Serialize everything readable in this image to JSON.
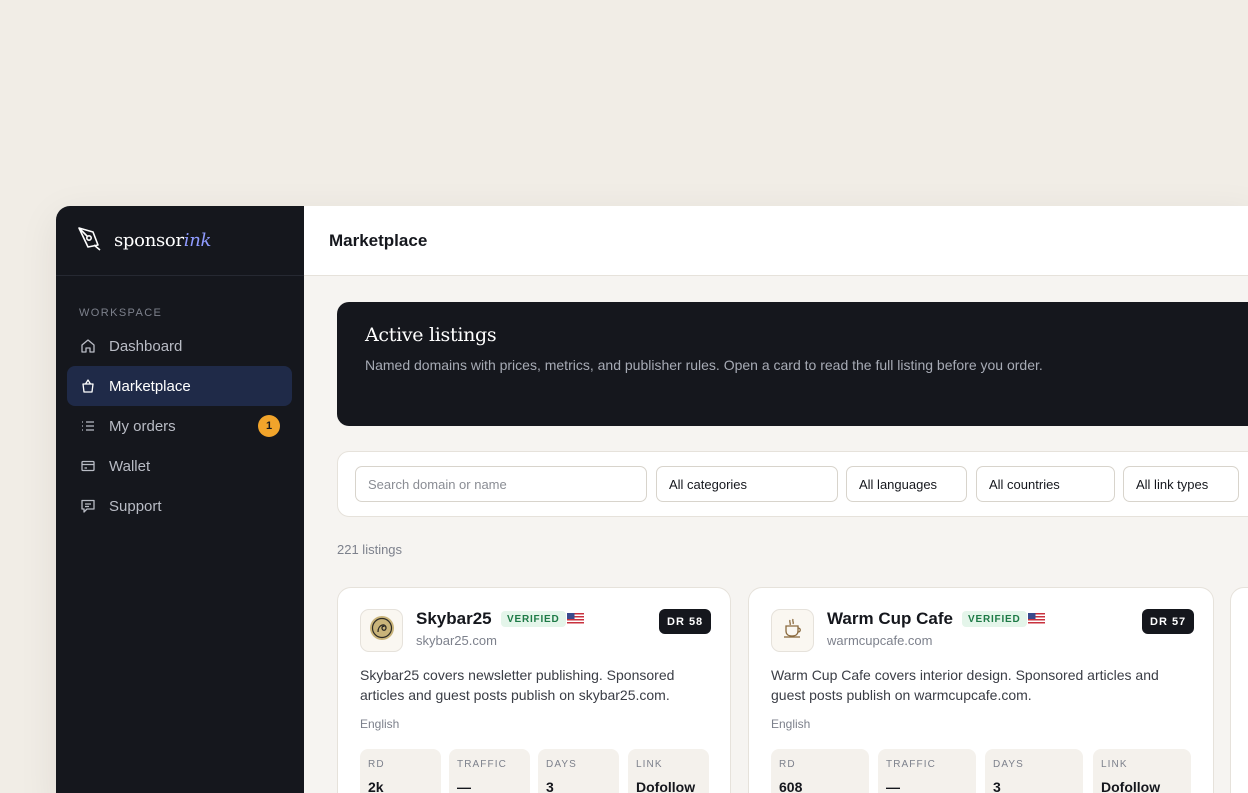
{
  "brand": {
    "name_plain": "sponsor",
    "name_accent": "ink"
  },
  "sidebar": {
    "section_label": "WORKSPACE",
    "items": [
      {
        "label": "Dashboard",
        "icon": "home-icon"
      },
      {
        "label": "Marketplace",
        "icon": "shopping-bag-icon",
        "active": true
      },
      {
        "label": "My orders",
        "icon": "list-icon",
        "badge": "1"
      },
      {
        "label": "Wallet",
        "icon": "wallet-icon"
      },
      {
        "label": "Support",
        "icon": "message-icon"
      }
    ]
  },
  "topbar": {
    "title": "Marketplace"
  },
  "hero": {
    "title": "Active listings",
    "description": "Named domains with prices, metrics, and publisher rules. Open a card to read the full listing before you order."
  },
  "filters": {
    "search_placeholder": "Search domain or name",
    "category": "All categories",
    "language": "All languages",
    "country": "All countries",
    "link_type": "All link types"
  },
  "listing_count": "221 listings",
  "cards": [
    {
      "name": "Skybar25",
      "verified_label": "VERIFIED",
      "domain": "skybar25.com",
      "dr": "DR 58",
      "description": "Skybar25 covers newsletter publishing. Sponsored articles and guest posts publish on skybar25.com.",
      "language": "English",
      "stats": [
        {
          "label": "RD",
          "value": "2k"
        },
        {
          "label": "TRAFFIC",
          "value": "—"
        },
        {
          "label": "DAYS",
          "value": "3"
        },
        {
          "label": "LINK",
          "value": "Dofollow"
        }
      ]
    },
    {
      "name": "Warm Cup Cafe",
      "verified_label": "VERIFIED",
      "domain": "warmcupcafe.com",
      "dr": "DR 57",
      "description": "Warm Cup Cafe covers interior design. Sponsored articles and guest posts publish on warmcupcafe.com.",
      "language": "English",
      "stats": [
        {
          "label": "RD",
          "value": "608"
        },
        {
          "label": "TRAFFIC",
          "value": "—"
        },
        {
          "label": "DAYS",
          "value": "3"
        },
        {
          "label": "LINK",
          "value": "Dofollow"
        }
      ]
    }
  ],
  "colors": {
    "sidebar_bg": "#15171d",
    "active_item_bg": "#1f2a48",
    "accent": "#8f9bff",
    "badge": "#f1a42b",
    "verified_text": "#1d7a46"
  }
}
